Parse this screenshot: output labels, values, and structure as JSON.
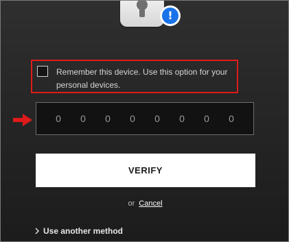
{
  "icons": {
    "lock": "lock-icon",
    "alert": "exclamation-icon",
    "arrow": "arrow-right-icon",
    "chevron": "chevron-right-icon"
  },
  "colors": {
    "highlight": "#e01b1b",
    "alert": "#1a73e8",
    "background": "#262626"
  },
  "alert_glyph": "!",
  "remember": {
    "label": "Remember this device. Use this option for your personal devices.",
    "checked": false
  },
  "code": {
    "placeholders": [
      "0",
      "0",
      "0",
      "0",
      "0",
      "0",
      "0",
      "0"
    ]
  },
  "verify_label": "VERIFY",
  "cancel": {
    "prefix": "or",
    "link": "Cancel"
  },
  "another_method_label": "Use another method"
}
